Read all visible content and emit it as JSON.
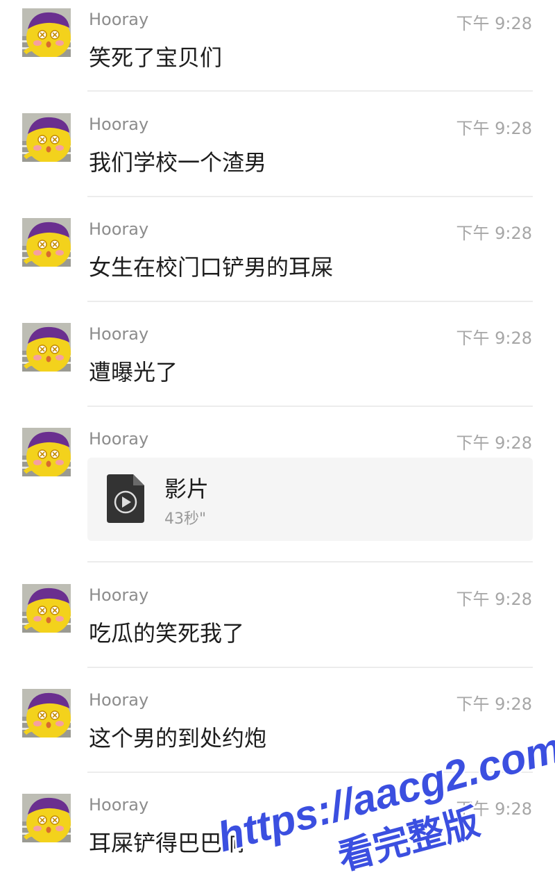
{
  "messages": [
    {
      "sender": "Hooray",
      "time": "下午 9:28",
      "text": "笑死了宝贝们"
    },
    {
      "sender": "Hooray",
      "time": "下午 9:28",
      "text": "我们学校一个渣男"
    },
    {
      "sender": "Hooray",
      "time": "下午 9:28",
      "text": "女生在校门口铲男的耳屎"
    },
    {
      "sender": "Hooray",
      "time": "下午 9:28",
      "text": "遭曝光了"
    },
    {
      "sender": "Hooray",
      "time": "下午 9:28",
      "video": {
        "title": "影片",
        "duration": "43秒\""
      }
    },
    {
      "sender": "Hooray",
      "time": "下午 9:28",
      "text": "吃瓜的笑死我了"
    },
    {
      "sender": "Hooray",
      "time": "下午 9:28",
      "text": "这个男的到处约炮"
    },
    {
      "sender": "Hooray",
      "time": "下午 9:28",
      "text": "耳屎铲得巴巴响"
    }
  ],
  "watermark": {
    "line1": "https://aacg2.com",
    "line2": "看完整版"
  },
  "colors": {
    "text": "#1d1d1d",
    "meta": "#8c8c8c",
    "watermark": "#3b4fe0"
  }
}
